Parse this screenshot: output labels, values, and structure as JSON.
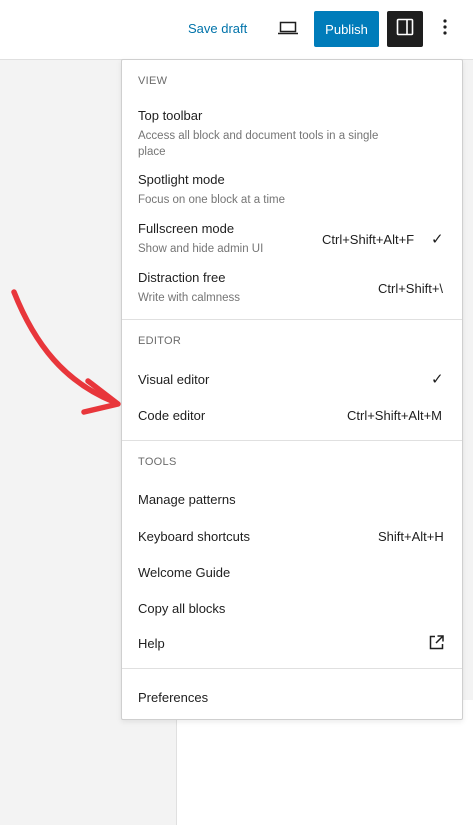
{
  "header": {
    "save_draft": "Save draft",
    "publish": "Publish",
    "preview_icon": "laptop-icon",
    "settings_icon": "sidebar-toggle-icon",
    "options_icon": "more-vertical-icon"
  },
  "menu": {
    "view": {
      "label": "VIEW",
      "top_toolbar": {
        "title": "Top toolbar",
        "desc": "Access all block and document tools in a single place"
      },
      "spotlight": {
        "title": "Spotlight mode",
        "desc": "Focus on one block at a time"
      },
      "fullscreen": {
        "title": "Fullscreen mode",
        "desc": "Show and hide admin UI",
        "shortcut": "Ctrl+Shift+Alt+F",
        "checked": true
      },
      "distraction": {
        "title": "Distraction free",
        "desc": "Write with calmness",
        "shortcut": "Ctrl+Shift+\\"
      }
    },
    "editor": {
      "label": "EDITOR",
      "visual": {
        "title": "Visual editor",
        "checked": true
      },
      "code": {
        "title": "Code editor",
        "shortcut": "Ctrl+Shift+Alt+M"
      }
    },
    "tools": {
      "label": "TOOLS",
      "manage_patterns": "Manage patterns",
      "keyboard_shortcuts": {
        "title": "Keyboard shortcuts",
        "shortcut": "Shift+Alt+H"
      },
      "welcome_guide": "Welcome Guide",
      "copy_all_blocks": "Copy all blocks",
      "help": "Help"
    },
    "preferences": "Preferences"
  },
  "check_glyph": "✓",
  "colors": {
    "accent": "#007cba",
    "annotation_arrow": "#e8363b"
  }
}
